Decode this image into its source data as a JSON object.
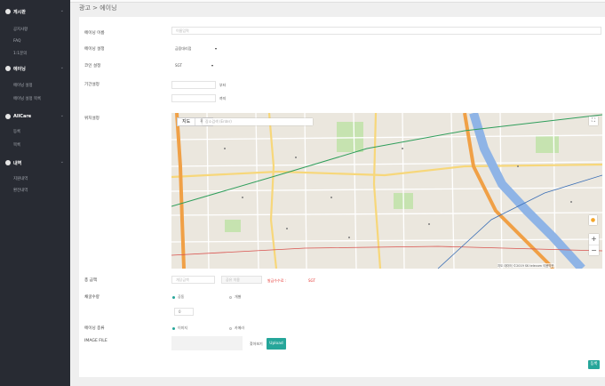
{
  "sidebar": {
    "groups": [
      {
        "label": "게시판",
        "items": [
          "공지사항",
          "FAQ",
          "1:1문의"
        ]
      },
      {
        "label": "에이닝",
        "items": [
          "에이닝 설정",
          "에이닝 설정 목록"
        ]
      },
      {
        "label": "AllCare",
        "items": [
          "등록",
          "목록"
        ]
      },
      {
        "label": "내역",
        "items": [
          "지원내역",
          "환전내역"
        ]
      }
    ]
  },
  "header": {
    "breadcrumb": "광고 > 에이닝"
  },
  "form": {
    "name": {
      "label": "에이닝 이름",
      "placeholder": "이름입력"
    },
    "setting": {
      "label": "에이닝 설정",
      "value": "금융대리점"
    },
    "coin": {
      "label": "코인 설정",
      "value": "SGT"
    },
    "period": {
      "label": "기간설정",
      "start_unit": "부터",
      "end_unit": "까지"
    },
    "location": {
      "label": "위치설정"
    },
    "total": {
      "label": "총 금액",
      "amount_placeholder": "개당금액",
      "count_placeholder": "공유 이용",
      "note": "발급수수료 :",
      "unit": "SGT"
    },
    "pay": {
      "label": "채굴수량",
      "options": [
        "공동",
        "개별"
      ],
      "value": "0"
    },
    "type": {
      "label": "에이닝 종류",
      "options": [
        "이미지",
        "카메라"
      ]
    },
    "image": {
      "label": "IMAGE FILE",
      "browse": "찾아보기",
      "upload": "Upload"
    },
    "submit": "등록"
  },
  "map": {
    "map_type": [
      "지도",
      "위성"
    ],
    "search_placeholder": "장소검색 (Enter)",
    "footer": "지도 데이터 ©2019 SK telecom 이용약관"
  },
  "colors": {
    "sidebar_bg": "#282b33",
    "accent": "#26a69a",
    "warning": "#e53935"
  }
}
